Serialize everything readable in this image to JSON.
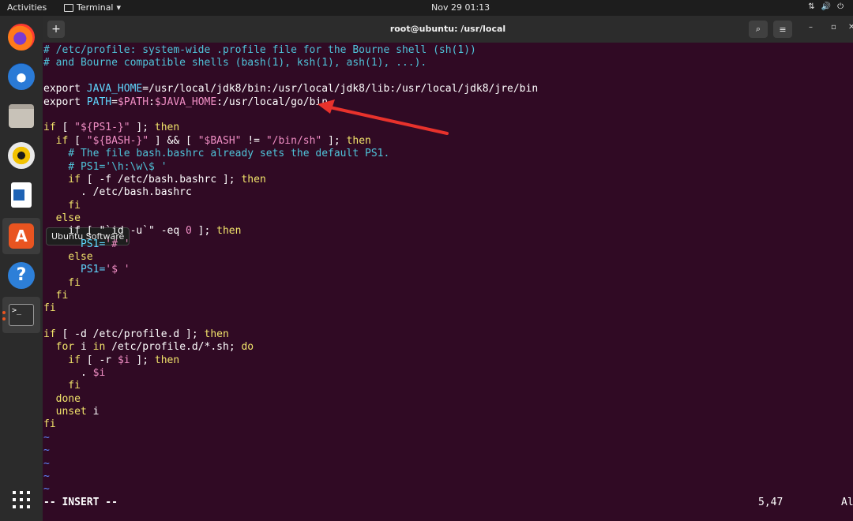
{
  "topbar": {
    "activities": "Activities",
    "app_menu": "Terminal",
    "app_menu_arrow": "▾",
    "clock": "Nov 29  01:13",
    "tray_icons": [
      "network-icon",
      "volume-icon",
      "power-icon"
    ]
  },
  "dock": {
    "items": [
      "firefox-icon",
      "thunderbird-icon",
      "files-icon",
      "rhythmbox-icon",
      "libreoffice-writer-icon",
      "ubuntu-software-icon",
      "help-icon",
      "terminal-icon",
      "show-applications-icon"
    ],
    "tooltip": "Ubuntu Software",
    "store_glyph": "A",
    "help_glyph": "?",
    "term_glyph": ">_"
  },
  "window": {
    "title": "root@ubuntu: /usr/local",
    "new_tab_glyph": "+",
    "search_glyph": "⌕",
    "menu_glyph": "≡",
    "min_glyph": "–",
    "max_glyph": "▫",
    "close_glyph": "✕"
  },
  "editor": {
    "lines": {
      "l1": "# /etc/profile: system-wide .profile file for the Bourne shell (sh(1))",
      "l2": "# and Bourne compatible shells (bash(1), ksh(1), ash(1), ...).",
      "l4a": "export ",
      "l4b": "JAVA_HOME",
      "l4c": "=/usr/local/jdk8/bin:/usr/local/jdk8/lib:/usr/local/jdk8/jre/bin",
      "l5a": "export ",
      "l5b": "PATH",
      "l5c": "=",
      "l5d": "$PATH",
      "l5e": ":",
      "l5f": "$JAVA_HOME",
      "l5g": ":/usr/local/go/bin",
      "l7a": "if",
      "l7b": " [ ",
      "l7c": "\"${PS1-}\"",
      "l7d": " ]; ",
      "l7e": "then",
      "l8a": "  if",
      "l8b": " [ ",
      "l8c": "\"${BASH-}\"",
      "l8d": " ] && [ ",
      "l8e": "\"$BASH\"",
      "l8f": " != ",
      "l8g": "\"/bin/sh\"",
      "l8h": " ]; ",
      "l8i": "then",
      "l9": "    # The file bash.bashrc already sets the default PS1.",
      "l10": "    # PS1='\\h:\\w\\$ '",
      "l11a": "    if",
      "l11b": " [ -f /etc/bash.bashrc ]; ",
      "l11c": "then",
      "l12": "      . /etc/bash.bashrc",
      "l13": "    fi",
      "l14": "  else",
      "l15a": "    if [ \"`id -u`\" -eq ",
      "l15b": "0",
      "l15c": " ]; ",
      "l15d": "then",
      "l16a": "      PS1=",
      "l16b": "'# '",
      "l17": "    else",
      "l18a": "      PS1=",
      "l18b": "'$ '",
      "l19": "    fi",
      "l20": "  fi",
      "l21": "fi",
      "l23a": "if",
      "l23b": " [ -d /etc/profile.d ]; ",
      "l23c": "then",
      "l24a": "  for",
      "l24b": " i ",
      "l24c": "in",
      "l24d": " /etc/profile.d/*.sh; ",
      "l24e": "do",
      "l25a": "    if",
      "l25b": " [ -r ",
      "l25c": "$i",
      "l25d": " ]; ",
      "l25e": "then",
      "l26a": "      . ",
      "l26b": "$i",
      "l27": "    fi",
      "l28": "  done",
      "l29a": "  unset",
      "l29b": " i",
      "l30": "fi"
    },
    "tilde": "~",
    "mode": "-- INSERT --",
    "cursor_pos": "5,47",
    "scroll": "Al"
  },
  "annotation_color": "#e8322c"
}
